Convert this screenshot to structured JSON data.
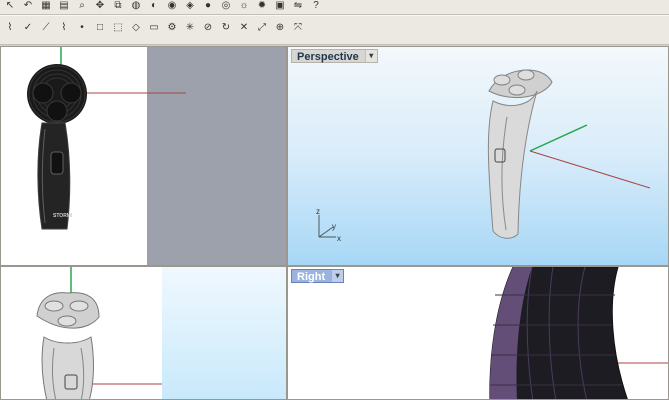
{
  "toolbar_top": {
    "icons": [
      "select-icon",
      "undo-icon",
      "grid-icon",
      "layer-icon",
      "zoom-icon",
      "pan-icon",
      "copy-icon",
      "sphere-icon",
      "shade-icon",
      "render-icon",
      "material-icon",
      "color-icon",
      "world-icon",
      "light-icon",
      "sun-icon",
      "snapshot-icon",
      "mirror-icon",
      "help-icon"
    ]
  },
  "toolbar_second": {
    "icons": [
      "curve-icon",
      "point-icon",
      "line-icon",
      "polyline-icon",
      "dot-icon",
      "box-icon",
      "cube-icon",
      "cube-edge-icon",
      "cylinder-icon",
      "gear-icon",
      "transform-icon",
      "no-entry-icon",
      "rotate-icon",
      "delete-icon",
      "scale-icon",
      "snap-icon",
      "explode-icon"
    ]
  },
  "viewports": {
    "top_left": {
      "label": ""
    },
    "perspective": {
      "label": "Perspective",
      "axes": {
        "z": "z",
        "y": "y",
        "x": "x"
      }
    },
    "bottom_left": {
      "label": ""
    },
    "right": {
      "label": "Right"
    }
  },
  "model": {
    "brand_text": "STORMI"
  }
}
